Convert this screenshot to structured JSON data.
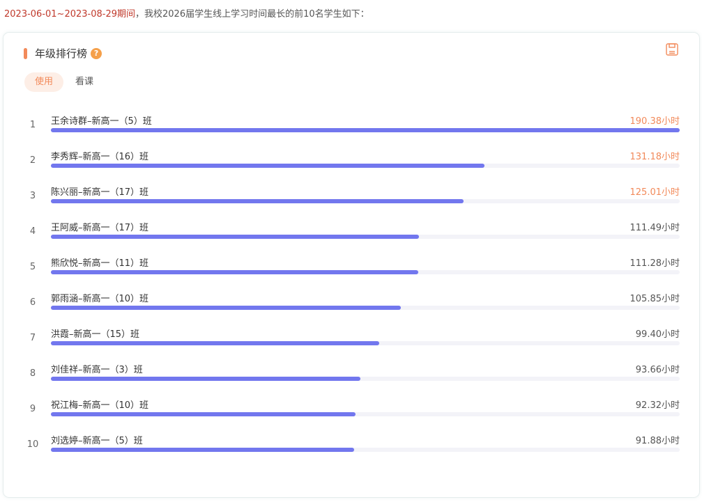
{
  "intro": {
    "range": "2023-06-01~2023-08-29期间",
    "text": "，我校2026届学生线上学习时间最长的前10名学生如下："
  },
  "panel": {
    "title": "年级排行榜",
    "help_icon": "?",
    "save_icon": "save-icon"
  },
  "tabs": [
    {
      "label": "使用",
      "active": true
    },
    {
      "label": "看课",
      "active": false
    }
  ],
  "colors": {
    "accent": "#f28a5a",
    "bar": "#7277ee",
    "track": "#f3f3f8",
    "range_text": "#c0392b"
  },
  "ranking": {
    "max": 190.38,
    "items": [
      {
        "rank": "1",
        "name": "王余诗群–新高一（5）班",
        "value": 190.38,
        "value_text": "190.38小时"
      },
      {
        "rank": "2",
        "name": "李秀辉–新高一（16）班",
        "value": 131.18,
        "value_text": "131.18小时"
      },
      {
        "rank": "3",
        "name": "陈兴丽–新高一（17）班",
        "value": 125.01,
        "value_text": "125.01小时"
      },
      {
        "rank": "4",
        "name": "王阿威–新高一（17）班",
        "value": 111.49,
        "value_text": "111.49小时"
      },
      {
        "rank": "5",
        "name": "熊欣悦–新高一（11）班",
        "value": 111.28,
        "value_text": "111.28小时"
      },
      {
        "rank": "6",
        "name": "郭雨涵–新高一（10）班",
        "value": 105.85,
        "value_text": "105.85小时"
      },
      {
        "rank": "7",
        "name": "洪霞–新高一（15）班",
        "value": 99.4,
        "value_text": "99.40小时"
      },
      {
        "rank": "8",
        "name": "刘佳祥–新高一（3）班",
        "value": 93.66,
        "value_text": "93.66小时"
      },
      {
        "rank": "9",
        "name": "祝江梅–新高一（10）班",
        "value": 92.32,
        "value_text": "92.32小时"
      },
      {
        "rank": "10",
        "name": "刘选婷–新高一（5）班",
        "value": 91.88,
        "value_text": "91.88小时"
      }
    ]
  }
}
